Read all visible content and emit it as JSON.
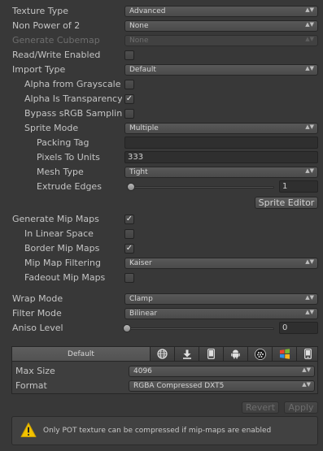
{
  "texture_type": {
    "label": "Texture Type",
    "value": "Advanced"
  },
  "non_power_of_2": {
    "label": "Non Power of 2",
    "value": "None"
  },
  "generate_cubemap": {
    "label": "Generate Cubemap",
    "value": "None"
  },
  "read_write": {
    "label": "Read/Write Enabled",
    "checked": false
  },
  "import_type": {
    "label": "Import Type",
    "value": "Default"
  },
  "alpha_from_grayscale": {
    "label": "Alpha from Grayscale",
    "checked": false
  },
  "alpha_is_transparency": {
    "label": "Alpha Is Transparency",
    "checked": true
  },
  "bypass_srgb": {
    "label": "Bypass sRGB Sampling",
    "checked": false
  },
  "sprite_mode": {
    "label": "Sprite Mode",
    "value": "Multiple"
  },
  "packing_tag": {
    "label": "Packing Tag",
    "value": ""
  },
  "pixels_to_units": {
    "label": "Pixels To Units",
    "value": "333"
  },
  "mesh_type": {
    "label": "Mesh Type",
    "value": "Tight"
  },
  "extrude_edges": {
    "label": "Extrude Edges",
    "value": "1"
  },
  "sprite_editor_button": "Sprite Editor",
  "generate_mip_maps": {
    "label": "Generate Mip Maps",
    "checked": true
  },
  "in_linear_space": {
    "label": "In Linear Space",
    "checked": false
  },
  "border_mip_maps": {
    "label": "Border Mip Maps",
    "checked": true
  },
  "mip_map_filtering": {
    "label": "Mip Map Filtering",
    "value": "Kaiser"
  },
  "fadeout_mip_maps": {
    "label": "Fadeout Mip Maps",
    "checked": false
  },
  "wrap_mode": {
    "label": "Wrap Mode",
    "value": "Clamp"
  },
  "filter_mode": {
    "label": "Filter Mode",
    "value": "Bilinear"
  },
  "aniso_level": {
    "label": "Aniso Level",
    "value": "0"
  },
  "platform_tabs": {
    "default_label": "Default",
    "icons": [
      "web-globe-icon",
      "standalone-download-icon",
      "mobile-phone-icon",
      "android-icon",
      "blackberry-icon",
      "windows-store-icon",
      "windows-phone-icon"
    ]
  },
  "max_size": {
    "label": "Max Size",
    "value": "4096"
  },
  "format": {
    "label": "Format",
    "value": "RGBA Compressed DXT5"
  },
  "revert_button": "Revert",
  "apply_button": "Apply",
  "warning": "Only POT texture can be compressed if mip-maps are enabled",
  "colors": {
    "background": "#383838",
    "text": "#c4c4c4",
    "disabled_text": "#6e6e6e",
    "warning_yellow": "#f2c200"
  }
}
